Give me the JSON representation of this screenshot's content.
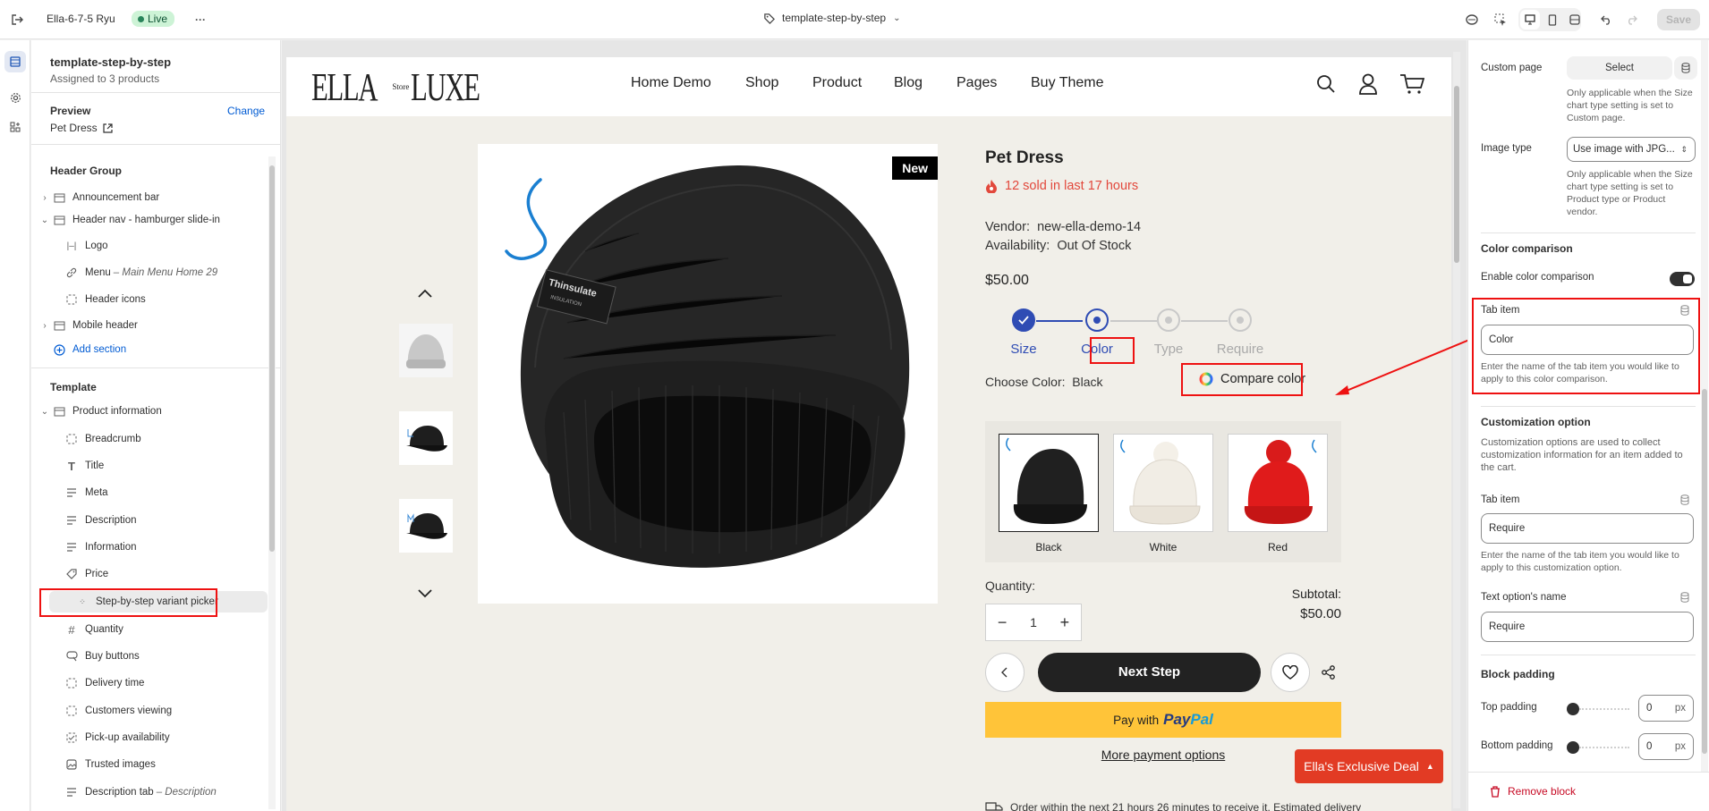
{
  "topbar": {
    "store_name": "Ella-6-7-5 Ryu",
    "live_label": "Live",
    "template_name": "template-step-by-step",
    "save_label": "Save"
  },
  "left": {
    "template_title": "template-step-by-step",
    "assigned": "Assigned to 3 products",
    "preview_label": "Preview",
    "change_label": "Change",
    "preview_product": "Pet Dress",
    "header_group_label": "Header Group",
    "header_items": [
      {
        "label": "Announcement bar",
        "icon": "section-icon"
      },
      {
        "label": "Header nav - hamburger slide-in",
        "icon": "section-icon"
      },
      {
        "label": "Logo",
        "icon": "logo-block-icon"
      },
      {
        "label": "Menu",
        "note": "– Main Menu Home 29",
        "icon": "link-icon"
      },
      {
        "label": "Header icons",
        "icon": "block-icon"
      },
      {
        "label": "Mobile header",
        "icon": "section-icon"
      }
    ],
    "add_section": "Add section",
    "template_label": "Template",
    "template_items": [
      {
        "label": "Product information",
        "icon": "section-icon"
      },
      {
        "label": "Breadcrumb",
        "icon": "block-icon"
      },
      {
        "label": "Title",
        "icon": "text-icon"
      },
      {
        "label": "Meta",
        "icon": "text-lines-icon"
      },
      {
        "label": "Description",
        "icon": "text-lines-icon"
      },
      {
        "label": "Information",
        "icon": "text-lines-icon"
      },
      {
        "label": "Price",
        "icon": "price-tag-icon"
      },
      {
        "label": "Step-by-step variant picker",
        "icon": "variant-icon"
      },
      {
        "label": "Quantity",
        "icon": "hash-icon"
      },
      {
        "label": "Buy buttons",
        "icon": "cart-button-icon"
      },
      {
        "label": "Delivery time",
        "icon": "block-icon"
      },
      {
        "label": "Customers viewing",
        "icon": "block-icon"
      },
      {
        "label": "Pick-up availability",
        "icon": "pickup-icon"
      },
      {
        "label": "Trusted images",
        "icon": "image-icon"
      },
      {
        "label": "Description tab",
        "note": "– Description",
        "icon": "text-lines-icon"
      }
    ]
  },
  "store": {
    "logo_left": "ELLA",
    "logo_mid": "Store",
    "logo_right": "LUXE",
    "nav": [
      "Home Demo",
      "Shop",
      "Product",
      "Blog",
      "Pages",
      "Buy Theme"
    ],
    "badge": "New",
    "product_title": "Pet Dress",
    "sold": "12 sold in last 17 hours",
    "vendor_label": "Vendor:",
    "vendor": "new-ella-demo-14",
    "availability_label": "Availability:",
    "availability": "Out Of Stock",
    "price": "$50.00",
    "steps": [
      "Size",
      "Color",
      "Type",
      "Require"
    ],
    "choose_label": "Choose Color:",
    "choose_value": "Black",
    "compare_label": "Compare color",
    "swatches": [
      "Black",
      "White",
      "Red"
    ],
    "quantity_label": "Quantity:",
    "quantity": "1",
    "subtotal_label": "Subtotal:",
    "subtotal": "$50.00",
    "next_step": "Next Step",
    "paypal_prefix": "Pay with",
    "paypal_a": "Pay",
    "paypal_b": "Pal",
    "more_payment": "More payment options",
    "deal": "Ella's Exclusive Deal",
    "delivery_text": "Order within the next 21 hours 26 minutes to receive it. Estimated delivery"
  },
  "right": {
    "custom_page_label": "Custom page",
    "select_label": "Select",
    "custom_page_help": "Only applicable when the Size chart type setting is set to Custom page.",
    "image_type_label": "Image type",
    "image_type_value": "Use image with JPG...",
    "image_type_help": "Only applicable when the Size chart type setting is set to Product type or Product vendor.",
    "color_comparison_head": "Color comparison",
    "enable_color_label": "Enable color comparison",
    "enable_color_on": true,
    "tab_item_label": "Tab item",
    "tab_item_value": "Color",
    "tab_item_help": "Enter the name of the tab item you would like to apply to this color comparison.",
    "customization_head": "Customization option",
    "customization_help": "Customization options are used to collect customization information for an item added to the cart.",
    "tab_item2_label": "Tab item",
    "tab_item2_value": "Require",
    "tab_item2_help": "Enter the name of the tab item you would like to apply to this customization option.",
    "text_option_label": "Text option's name",
    "text_option_value": "Require",
    "block_padding_head": "Block padding",
    "top_padding_label": "Top padding",
    "top_padding_value": "0",
    "bottom_padding_label": "Bottom padding",
    "bottom_padding_value": "0",
    "px_unit": "px",
    "remove_block": "Remove block"
  },
  "colors": {
    "accent": "#2f4cb4",
    "highlight": "#ee1111",
    "sold_red": "#e2483c",
    "paypal_yellow": "#ffc439",
    "deal_red": "#e23b24"
  }
}
